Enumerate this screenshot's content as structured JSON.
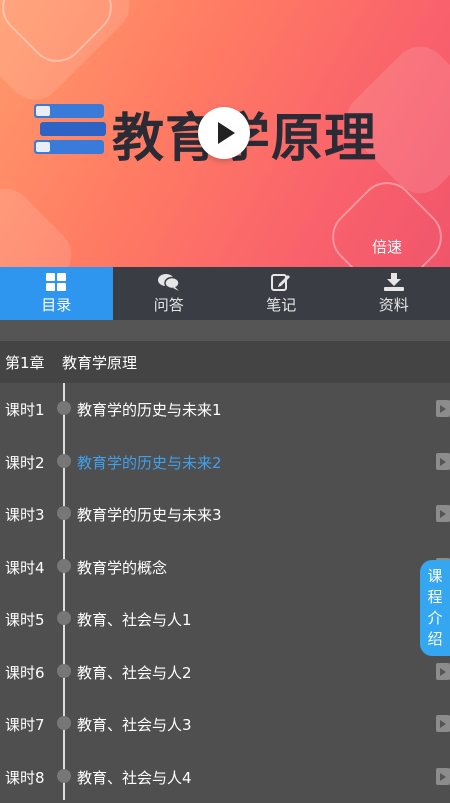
{
  "video": {
    "title": "教育学原理",
    "speed_label": "倍速"
  },
  "tabs": [
    {
      "label": "目录",
      "icon": "grid-icon",
      "active": true
    },
    {
      "label": "问答",
      "icon": "chat-icon",
      "active": false
    },
    {
      "label": "笔记",
      "icon": "edit-note-icon",
      "active": false
    },
    {
      "label": "资料",
      "icon": "download-icon",
      "active": false
    }
  ],
  "chapter": {
    "number": "第1章",
    "title": "教育学原理"
  },
  "lessons": [
    {
      "number": "课时1",
      "title": "教育学的历史与未来1",
      "active": false
    },
    {
      "number": "课时2",
      "title": "教育学的历史与未来2",
      "active": true
    },
    {
      "number": "课时3",
      "title": "教育学的历史与未来3",
      "active": false
    },
    {
      "number": "课时4",
      "title": "教育学的概念",
      "active": false
    },
    {
      "number": "课时5",
      "title": "教育、社会与人1",
      "active": false
    },
    {
      "number": "课时6",
      "title": "教育、社会与人2",
      "active": false
    },
    {
      "number": "课时7",
      "title": "教育、社会与人3",
      "active": false
    },
    {
      "number": "课时8",
      "title": "教育、社会与人4",
      "active": false
    }
  ],
  "intro_tab": {
    "chars": [
      "课",
      "程",
      "介",
      "绍"
    ]
  },
  "colors": {
    "accent": "#2e96ee",
    "active_text": "#3fa0ef"
  }
}
